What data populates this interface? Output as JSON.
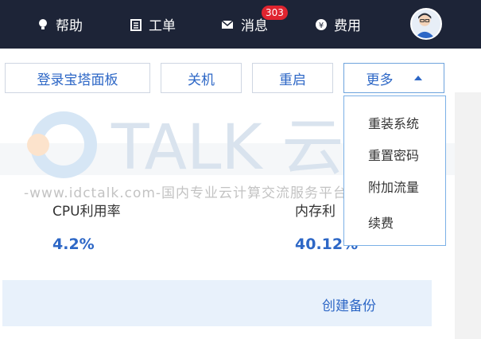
{
  "nav": {
    "help": "帮助",
    "ticket": "工单",
    "message": "消息",
    "message_badge": "303",
    "fees": "费用"
  },
  "toolbar": {
    "login_panel": "登录宝塔面板",
    "shutdown": "关机",
    "restart": "重启",
    "more": "更多"
  },
  "dropdown": {
    "items": [
      "重装系统",
      "重置密码",
      "附加流量",
      "续费"
    ]
  },
  "metrics": {
    "cpu_label": "CPU利用率",
    "cpu_value": "4.2%",
    "mem_label": "内存利",
    "mem_value": "40.12%"
  },
  "backup": {
    "create": "创建备份"
  },
  "watermark": {
    "logo": "TALK 云说",
    "url": "-www.idctalk.com-国内专业云计算交流服务平台-"
  },
  "colors": {
    "topbar": "#1d2437",
    "accent": "#2d67c6",
    "badge": "#e0242f",
    "highlight": "#ffff3a"
  }
}
